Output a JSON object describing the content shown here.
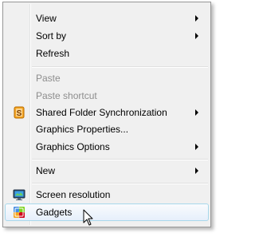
{
  "menu": {
    "group1": [
      {
        "label": "View",
        "submenu": true
      },
      {
        "label": "Sort by",
        "submenu": true
      },
      {
        "label": "Refresh",
        "submenu": false
      }
    ],
    "group2": [
      {
        "label": "Paste",
        "disabled": true
      },
      {
        "label": "Paste shortcut",
        "disabled": true
      },
      {
        "label": "Shared Folder Synchronization",
        "submenu": true,
        "icon": "shared-folder-sync-icon"
      },
      {
        "label": "Graphics Properties...",
        "submenu": false
      },
      {
        "label": "Graphics Options",
        "submenu": true
      }
    ],
    "group3": [
      {
        "label": "New",
        "submenu": true
      }
    ],
    "group4": [
      {
        "label": "Screen resolution",
        "icon": "monitor-icon"
      },
      {
        "label": "Gadgets",
        "icon": "gadgets-icon",
        "highlighted": true
      }
    ]
  },
  "colors": {
    "menu_bg": "#f0f0f0",
    "hover_border": "#a8d8eb",
    "disabled_text": "#8d8d8d"
  }
}
